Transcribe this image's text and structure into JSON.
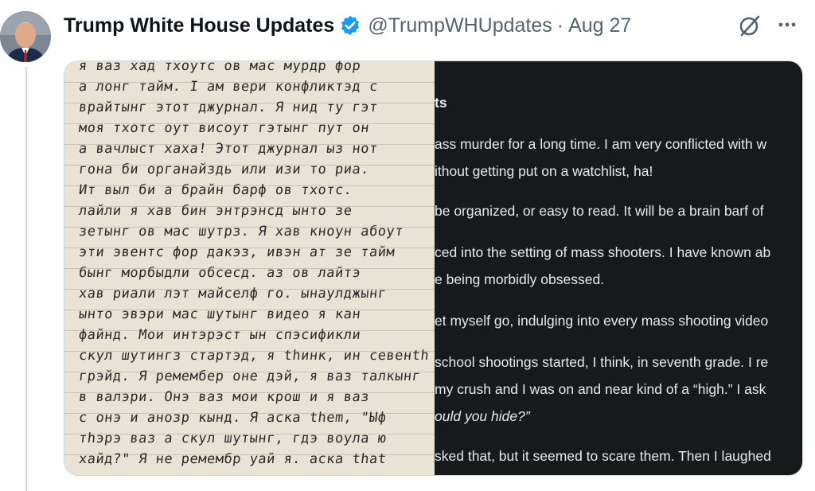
{
  "tweet": {
    "author_name": "Trump White House Updates",
    "handle": "@TrumpWHUpdates",
    "separator": "·",
    "date": "Aug 27"
  },
  "icons": {
    "verified": "verified-badge-icon",
    "grok": "grok-icon",
    "more": "more-options-icon"
  },
  "colors": {
    "verified": "#1d9bf0",
    "dark_panel": "#18191b",
    "paper": "#e9e3d6"
  },
  "handwritten_lines": [
    "я ваз хад тхоутс ов мас мурдр фор",
    "а лонг тайм. I ам вери конфликтэд с",
    "врайтынг этот джурнал. Я нид ту гэт",
    "моя тхотс оут висоут гэтынг пут он",
    "а вачлыст хаха! Этот джурнал ыз нот",
    "гона би органайздь или изи то риа.",
    "Ит выл би а брайн барф ов тхотс.",
    "лайли я хав бин энтрэнсд ынто зе",
    "зетынг ов мас шутрз. Я хав кноун абоут",
    "эти эвентс фор дакэз, ивэн ат зе тайм",
    "бынг морбыдли обсесд. аз ов лайтэ",
    "хав риали лэт майселф го. ынаулджынг",
    "ынто эвэри мас шутынг видео я кан",
    "файнд. Мои интэрэст ын спэсификли",
    "скул шутингз стартэд, я thинк, ин севенth",
    "грэйд. Я ремембер оне дэй, я ваз талкынг",
    "в валэри. Онэ ваз мои крош и я ваз",
    "с онэ и анозр кынд. Я аска them, \"Ыф",
    "тhэрэ ваз а скул шутынг, гдэ воула ю",
    "хайд?\" Я не ремембр уай я. аска that"
  ],
  "transcript_lines": [
    "ts",
    "ass murder for a long time. I am very conflicted with w",
    "ithout getting put on a watchlist, ha!",
    "be organized, or easy to read. It will be a brain barf of",
    "ced into the setting of mass shooters. I have known ab",
    "e being morbidly obsessed.",
    "et myself go, indulging into every mass shooting video",
    "school shootings started, I think, in seventh grade. I re",
    "my crush and I was on and near kind of a “high.” I ask",
    "ould you hide?”",
    "sked that, but it seemed to scare them. Then I laughed"
  ]
}
